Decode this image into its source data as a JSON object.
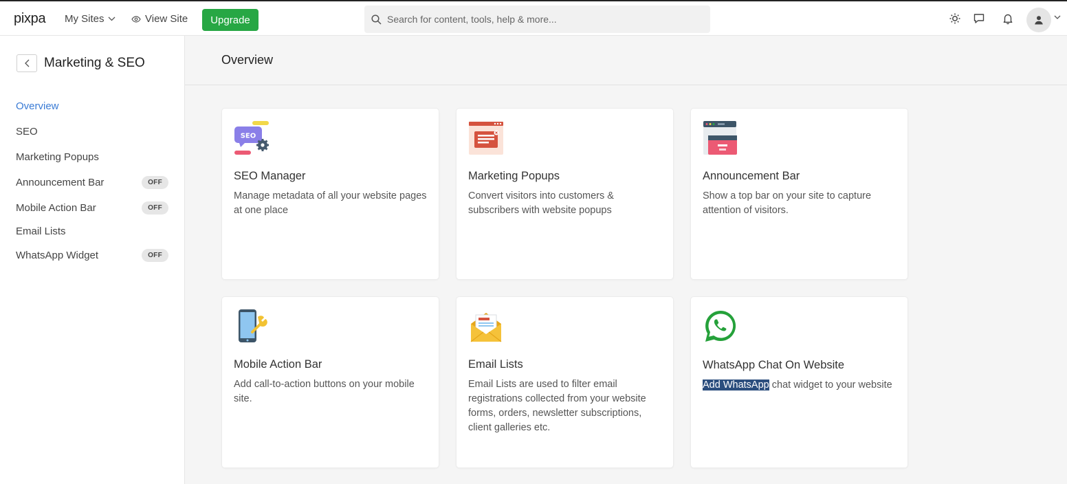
{
  "topbar": {
    "logo": "pixpa",
    "my_sites": "My Sites",
    "view_site": "View Site",
    "upgrade": "Upgrade",
    "search_placeholder": "Search for content, tools, help & more..."
  },
  "sidebar": {
    "title": "Marketing & SEO",
    "items": [
      {
        "label": "Overview",
        "active": true
      },
      {
        "label": "SEO"
      },
      {
        "label": "Marketing Popups"
      },
      {
        "label": "Announcement Bar",
        "badge": "OFF"
      },
      {
        "label": "Mobile Action Bar",
        "badge": "OFF"
      },
      {
        "label": "Email Lists"
      },
      {
        "label": "WhatsApp Widget",
        "badge": "OFF"
      }
    ]
  },
  "main": {
    "title": "Overview",
    "cards": [
      {
        "icon": "seo-manager-icon",
        "title": "SEO Manager",
        "desc": "Manage metadata of all your website pages at one place"
      },
      {
        "icon": "marketing-popups-icon",
        "title": "Marketing Popups",
        "desc": "Convert visitors into customers & subscribers with website popups"
      },
      {
        "icon": "announcement-bar-icon",
        "title": "Announcement Bar",
        "desc": "Show a top bar on your site to capture attention of visitors."
      },
      {
        "icon": "mobile-action-bar-icon",
        "title": "Mobile Action Bar",
        "desc": "Add call-to-action buttons on your mobile site."
      },
      {
        "icon": "email-lists-icon",
        "title": "Email Lists",
        "desc": "Email Lists are used to filter email registrations collected from your website forms, orders, newsletter subscriptions, client galleries etc."
      },
      {
        "icon": "whatsapp-icon",
        "title": "WhatsApp Chat On Website",
        "desc_highlight": "Add WhatsApp",
        "desc_rest": " chat widget to your website"
      }
    ]
  },
  "colors": {
    "accent": "#3a7bd5",
    "upgrade": "#27a744",
    "whatsapp": "#25a13a",
    "selection": "#2b4e7e"
  }
}
